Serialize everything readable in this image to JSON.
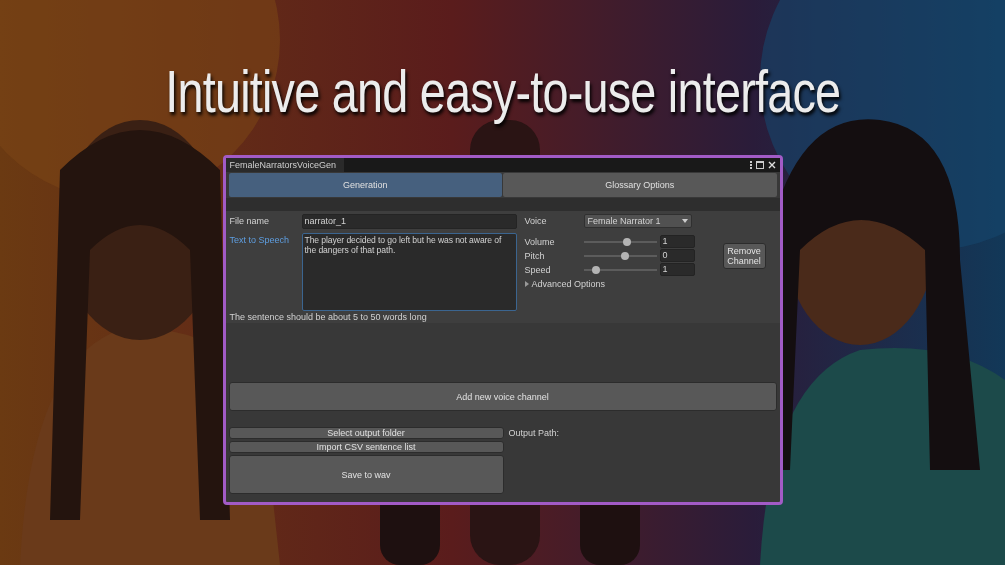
{
  "headline": "Intuitive and easy-to-use interface",
  "window": {
    "title": "FemaleNarratorsVoiceGen"
  },
  "tabs": [
    {
      "label": "Generation",
      "selected": true
    },
    {
      "label": "Glossary Options",
      "selected": false
    }
  ],
  "channel": {
    "file_name_label": "File name",
    "file_name": "narrator_1",
    "text_label": "Text to Speech",
    "text": "The player decided to go left but he was not aware of the dangers of that path.",
    "voice_label": "Voice",
    "voice": "Female Narrator 1",
    "sliders": [
      {
        "label": "Volume",
        "level": 0.6,
        "value": "1"
      },
      {
        "label": "Pitch",
        "level": 0.57,
        "value": "0"
      },
      {
        "label": "Speed",
        "level": 0.17,
        "value": "1"
      }
    ],
    "remove_button": "Remove Channel",
    "advanced": {
      "label": "Advanced Options",
      "expanded": false
    },
    "hint": "The sentence should be about 5 to 50 words long"
  },
  "add_button": "Add new voice channel",
  "output": {
    "buttons": [
      "Select output folder",
      "Import CSV sentence list",
      "Save to wav"
    ],
    "path_label": "Output Path:"
  }
}
